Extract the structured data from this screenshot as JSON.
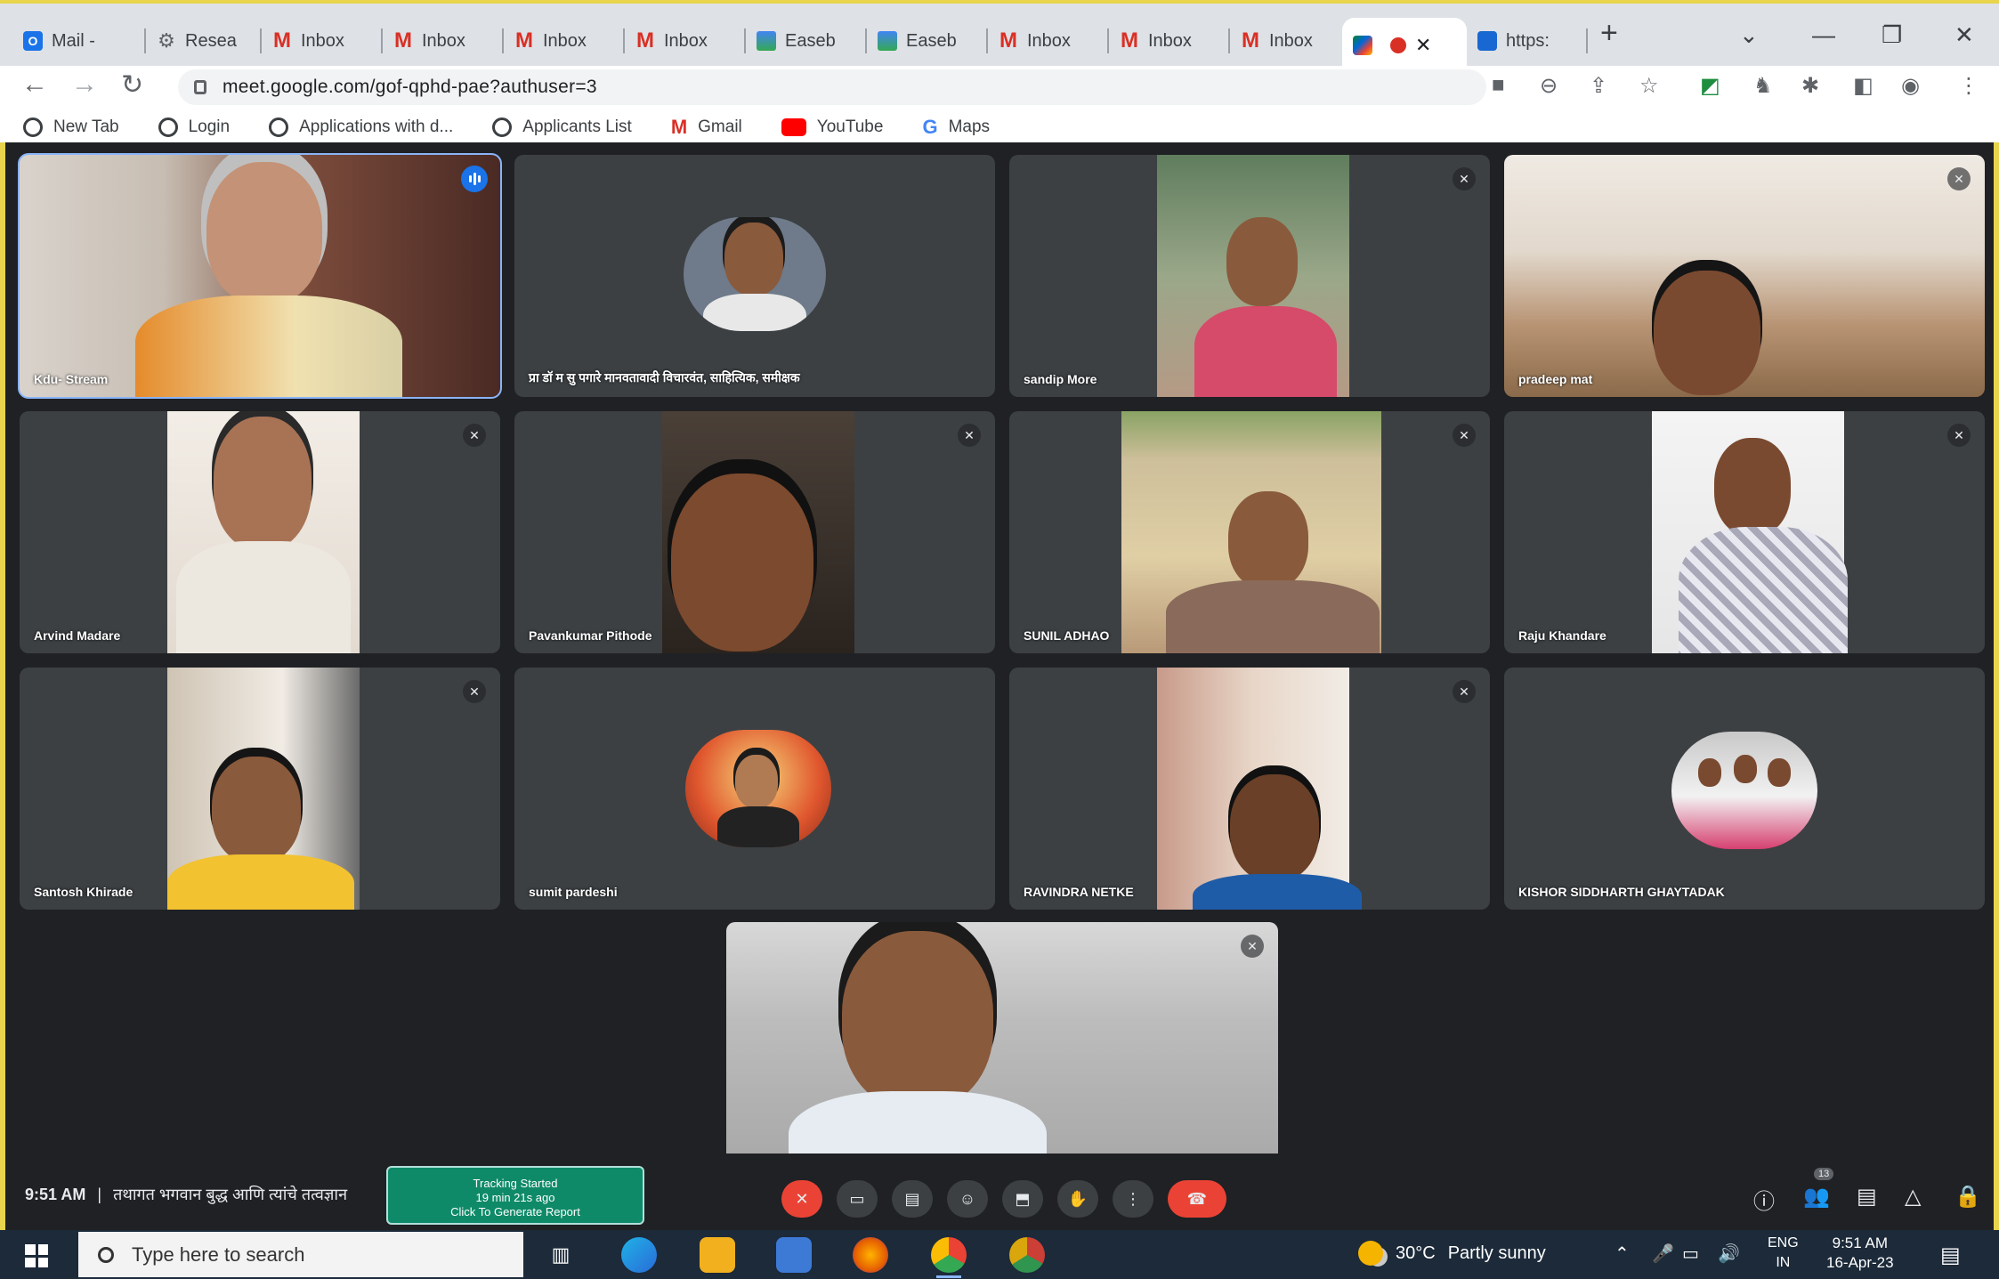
{
  "browser": {
    "tabs": [
      {
        "label": "Mail -",
        "icon": "mail-icon"
      },
      {
        "label": "Resea",
        "icon": "research-icon"
      },
      {
        "label": "Inbox",
        "icon": "gmail-icon"
      },
      {
        "label": "Inbox",
        "icon": "gmail-icon"
      },
      {
        "label": "Inbox",
        "icon": "gmail-icon"
      },
      {
        "label": "Inbox",
        "icon": "gmail-icon"
      },
      {
        "label": "Easeb",
        "icon": "easebuzz-icon"
      },
      {
        "label": "Easeb",
        "icon": "easebuzz-icon"
      },
      {
        "label": "Inbox",
        "icon": "gmail-icon"
      },
      {
        "label": "Inbox",
        "icon": "gmail-icon"
      },
      {
        "label": "Inbox",
        "icon": "gmail-icon"
      },
      {
        "label": "",
        "icon": "meet-icon",
        "active": true
      },
      {
        "label": "https:",
        "icon": "web-icon"
      }
    ],
    "new_tab": "+",
    "url": "meet.google.com/gof-qphd-pae?authuser=3",
    "bookmarks": [
      {
        "label": "New Tab",
        "icon": "globe-icon"
      },
      {
        "label": "Login",
        "icon": "globe-icon"
      },
      {
        "label": "Applications with d...",
        "icon": "globe-icon"
      },
      {
        "label": "Applicants List",
        "icon": "globe-icon"
      },
      {
        "label": "Gmail",
        "icon": "gmail-icon"
      },
      {
        "label": "YouTube",
        "icon": "youtube-icon"
      },
      {
        "label": "Maps",
        "icon": "google-icon"
      }
    ]
  },
  "meeting": {
    "participants": [
      {
        "name": "Kdu- Stream",
        "speaking": true
      },
      {
        "name": "प्रा डॉ म सु पगारे मानवतावादी विचारवंत, साहित्यिक, समीक्षक"
      },
      {
        "name": "sandip More"
      },
      {
        "name": "pradeep mat"
      },
      {
        "name": "Arvind Madare"
      },
      {
        "name": "Pavankumar Pithode"
      },
      {
        "name": "SUNIL ADHAO"
      },
      {
        "name": "Raju Khandare"
      },
      {
        "name": "Santosh Khirade"
      },
      {
        "name": "sumit pardeshi"
      },
      {
        "name": "RAVINDRA NETKE"
      },
      {
        "name": "KISHOR SIDDHARTH GHAYTADAK"
      }
    ],
    "self_tile": {
      "name": ""
    },
    "time": "9:51 AM",
    "separator": "|",
    "meeting_title": "तथागत भगवान बुद्ध आणि त्यांचे तत्वज्ञान",
    "tracking": {
      "line1": "Tracking Started",
      "line2": "19 min 21s ago",
      "line3": "Click To Generate Report"
    },
    "participant_badge": "13"
  },
  "taskbar": {
    "search_placeholder": "Type here to search",
    "weather_temp": "30°C",
    "weather_desc": "Partly sunny",
    "lang_top": "ENG",
    "lang_bottom": "IN",
    "time": "9:51 AM",
    "date": "16-Apr-23"
  },
  "colors": {
    "meet_bg": "#202124",
    "tile_bg": "#3c4043",
    "end_call_red": "#ea4335",
    "tracking_green": "#0f8a68",
    "highlight_border": "#e8d44d"
  }
}
